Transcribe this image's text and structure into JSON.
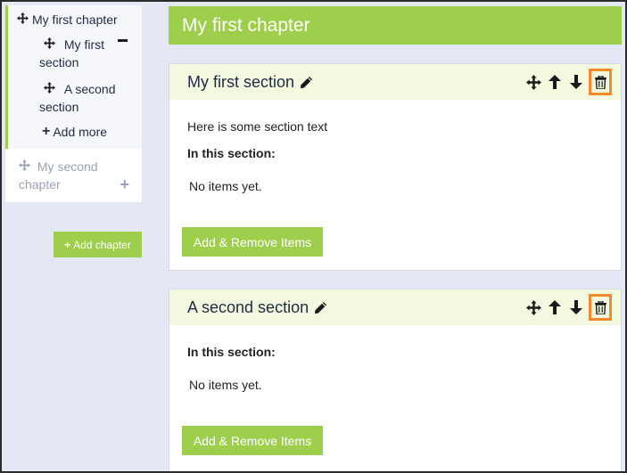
{
  "sidebar": {
    "active_chapter": {
      "title": "My first chapter",
      "sections": [
        {
          "label": "My first section"
        },
        {
          "label": "A second section"
        }
      ],
      "add_more_label": "Add more"
    },
    "inactive_chapter": {
      "title": "My second chapter"
    },
    "add_chapter_label": "Add chapter"
  },
  "main": {
    "chapter_title": "My first chapter",
    "sections": [
      {
        "title": "A second section",
        "text": "",
        "in_section_label": "In this section:",
        "empty_text": "No items yet.",
        "button_label": "Add & Remove Items"
      }
    ],
    "first_section": {
      "title": "My first section",
      "text": "Here is some section text",
      "in_section_label": "In this section:",
      "empty_text": "No items yet.",
      "button_label": "Add & Remove Items"
    }
  },
  "colors": {
    "accent_green": "#9ecf4c",
    "section_header_bg": "#f3f9de",
    "highlight_orange": "#f08a2b",
    "background": "#e4e8f4"
  },
  "icons": [
    "move-icon",
    "arrow-up-icon",
    "arrow-down-icon",
    "trash-icon",
    "pencil-icon",
    "plus-icon",
    "minus-icon"
  ]
}
